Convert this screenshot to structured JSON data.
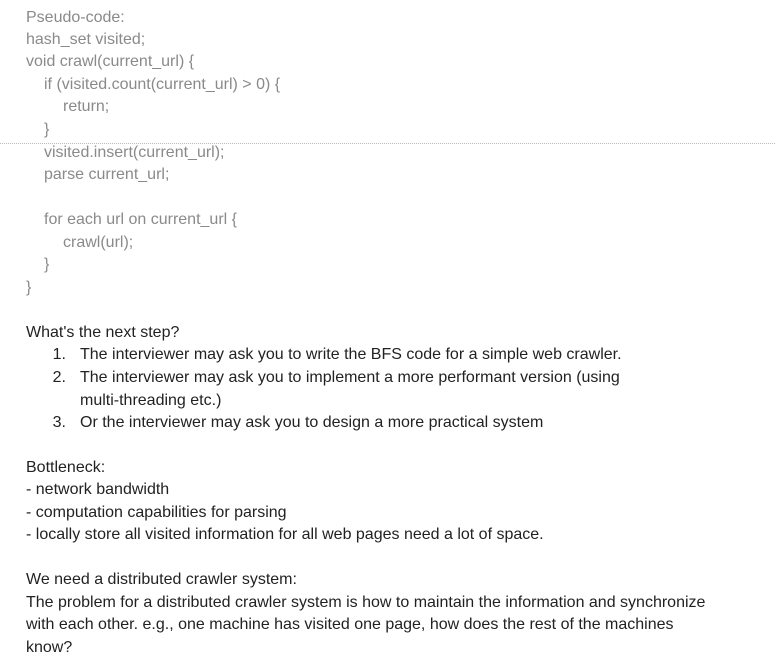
{
  "code": {
    "lines": [
      "Pseudo-code:",
      "hash_set visited;",
      "void crawl(current_url) {",
      "if (visited.count(current_url) > 0) {",
      "return;",
      "}",
      "visited.insert(current_url);",
      "parse current_url;",
      "for each url on current_url {",
      "crawl(url);",
      "}",
      "}"
    ]
  },
  "next_step": {
    "heading": "What's the next step?",
    "items": [
      {
        "num": "1.",
        "text": "The interviewer may ask you to write the BFS code for a simple web crawler."
      },
      {
        "num": "2.",
        "text": "The interviewer may ask you to implement a more performant version (using multi-threading etc.)"
      },
      {
        "num": "3.",
        "text": "Or the interviewer may ask you to design a more practical system"
      }
    ]
  },
  "bottleneck": {
    "heading": "Bottleneck:",
    "items": [
      "- network bandwidth",
      "- computation capabilities for parsing",
      "- locally store all visited information for all web pages need a lot of space."
    ]
  },
  "distributed": {
    "heading": "We need a distributed crawler system:",
    "paragraph_lines": [
      "The problem for a distributed crawler system is how to maintain the information and synchronize",
      "with each other. e.g., one machine has visited one page, how does the rest of the machines",
      "know?"
    ]
  }
}
